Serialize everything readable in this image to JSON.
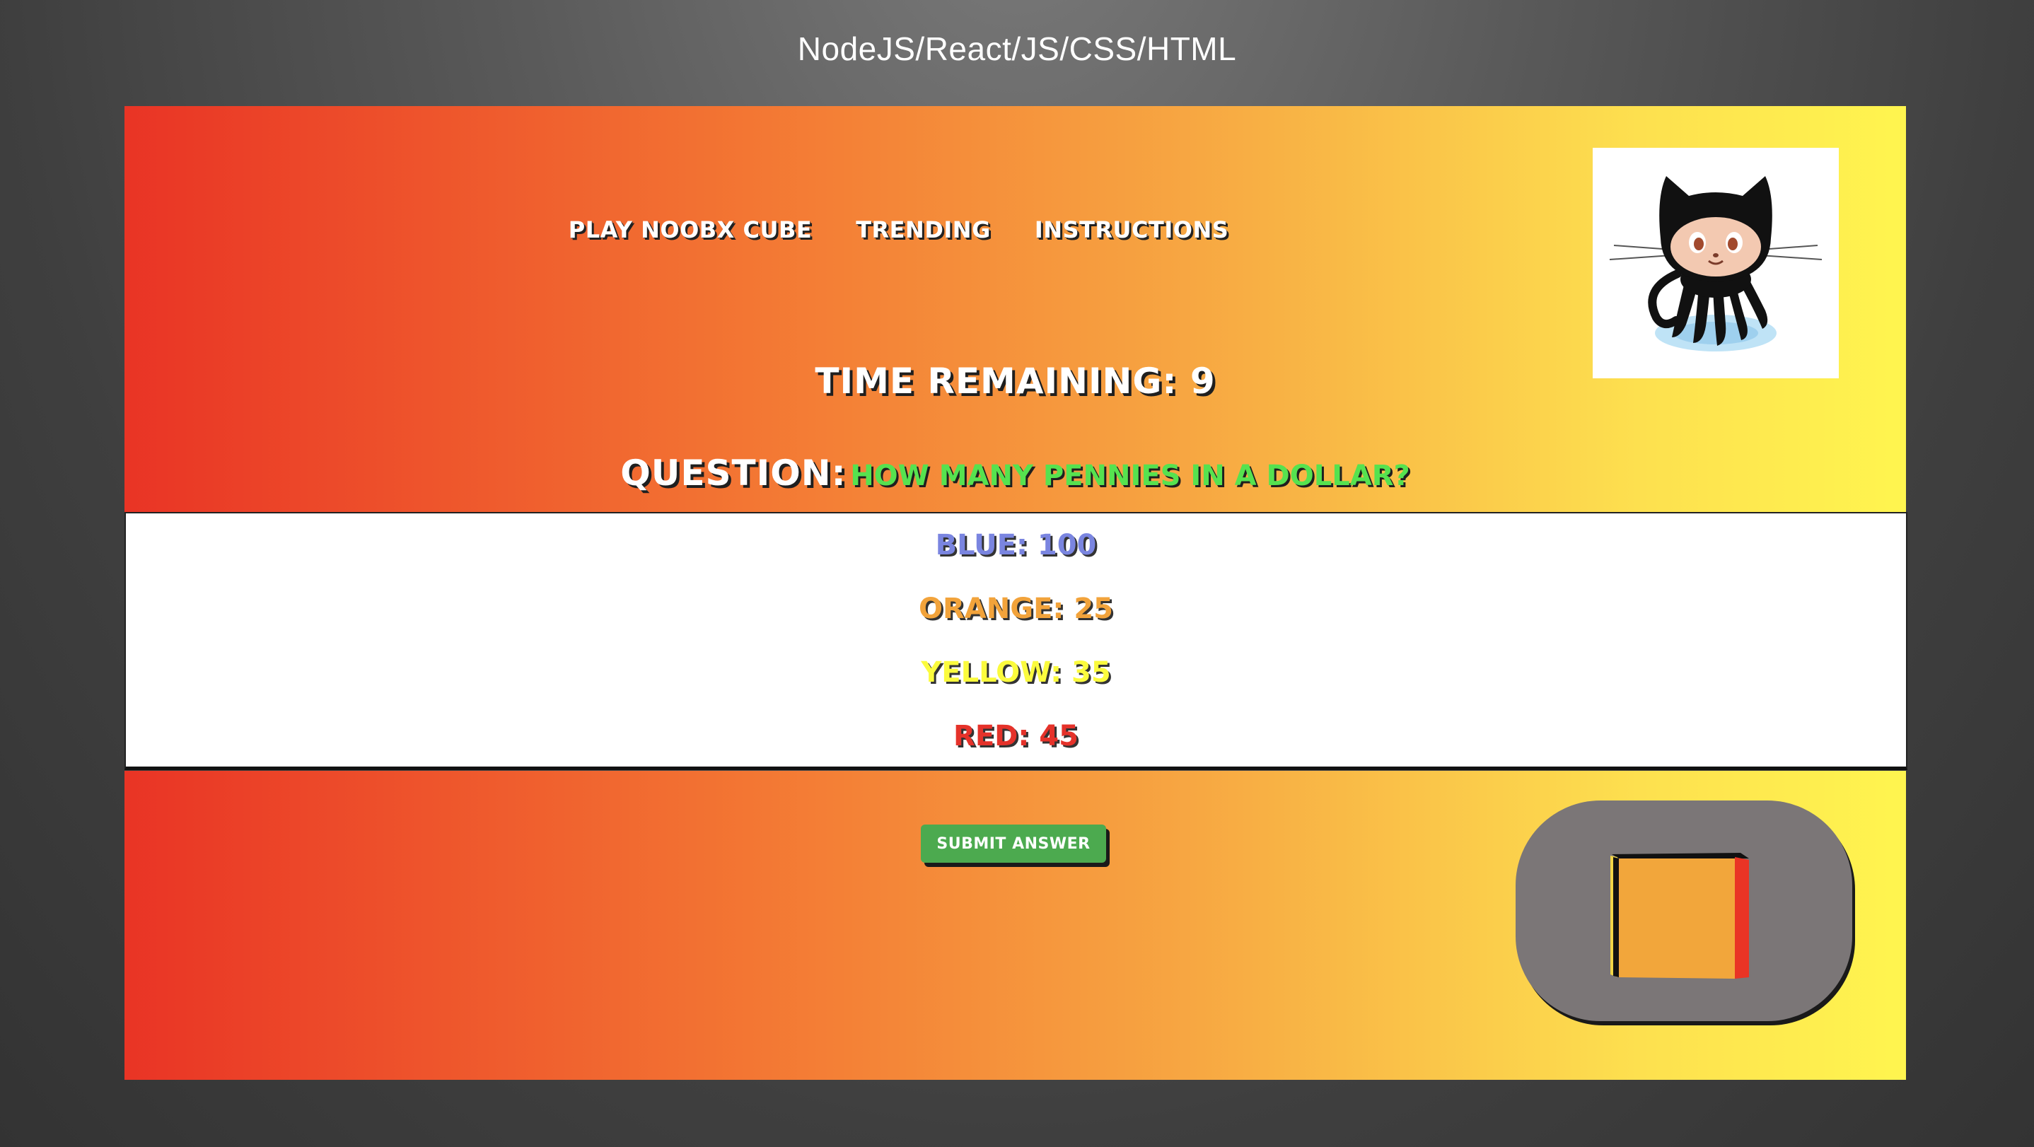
{
  "header": {
    "title": "NodeJS/React/JS/CSS/HTML"
  },
  "nav": {
    "items": [
      {
        "label": "Play Noobx Cube"
      },
      {
        "label": "Trending"
      },
      {
        "label": "Instructions"
      }
    ]
  },
  "avatar": {
    "icon": "octocat-icon"
  },
  "game": {
    "timer_label": "Time Remaining: 9",
    "question_label": "Question:",
    "question_text": "How many pennies in a dollar?",
    "answers": [
      {
        "label": "Blue: 100",
        "color": "#7a85e0"
      },
      {
        "label": "Orange: 25",
        "color": "#f2a33b"
      },
      {
        "label": "Yellow: 35",
        "color": "#fbfb3d"
      },
      {
        "label": "Red: 45",
        "color": "#e5322a"
      }
    ],
    "submit_label": "Submit Answer"
  },
  "colors": {
    "gradient_start": "#e93425",
    "gradient_end": "#fff54f",
    "cube_front": "#f2a63b",
    "cube_side": "#e93425",
    "cube_stage": "#7b7677",
    "submit": "#4caa4f"
  }
}
